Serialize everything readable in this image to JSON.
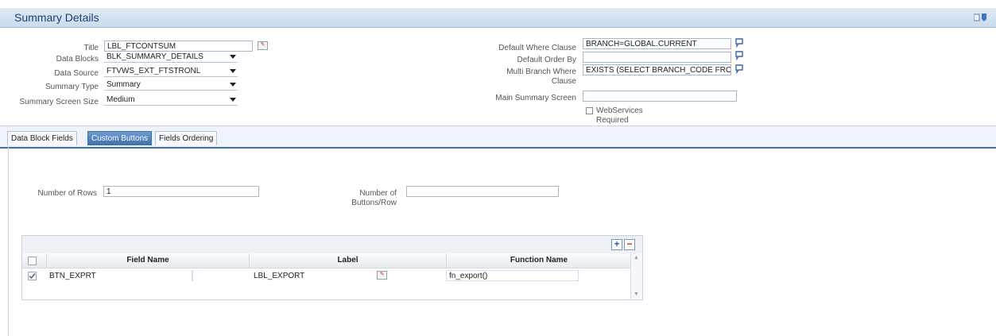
{
  "window": {
    "title": "Summary Details",
    "icons": [
      "export-icon",
      "help-icon"
    ]
  },
  "form_left": {
    "title_label": "Title",
    "title_value": "LBL_FTCONTSUM",
    "data_blocks_label": "Data Blocks",
    "data_blocks_value": "BLK_SUMMARY_DETAILS",
    "data_source_label": "Data Source",
    "data_source_value": "FTVWS_EXT_FTSTRONL",
    "summary_type_label": "Summary Type",
    "summary_type_value": "Summary",
    "screen_size_label": "Summary Screen Size",
    "screen_size_value": "Medium"
  },
  "form_right": {
    "default_where_label": "Default Where Clause",
    "default_where_value": "BRANCH=GLOBAL.CURRENT",
    "default_order_label": "Default Order By",
    "default_order_value": "",
    "multi_branch_label_1": "Multi Branch Where",
    "multi_branch_label_2": "Clause",
    "multi_branch_value": "EXISTS (SELECT BRANCH_CODE FROM",
    "main_summary_label": "Main Summary Screen",
    "main_summary_value": "",
    "webservices_label_1": "WebServices",
    "webservices_label_2": "Required",
    "webservices_checked": false
  },
  "tabs": [
    {
      "label": "Data Block Fields",
      "active": false
    },
    {
      "label": "Custom Buttons",
      "active": true
    },
    {
      "label": "Fields Ordering",
      "active": false
    }
  ],
  "custom_buttons": {
    "rows_label": "Number of Rows",
    "rows_value": "1",
    "per_row_label_1": "Number of",
    "per_row_label_2": "Buttons/Row",
    "per_row_value": ""
  },
  "grid": {
    "add_label": "+",
    "remove_label": "−",
    "columns": [
      "Field Name",
      "Label",
      "Function Name"
    ],
    "rows": [
      {
        "checked": true,
        "field_name": "BTN_EXPRT",
        "label": "LBL_EXPORT",
        "function_name": "fn_export()"
      }
    ]
  },
  "colors": {
    "accent": "#3d6fa8",
    "title_text": "#1f3f6b"
  }
}
